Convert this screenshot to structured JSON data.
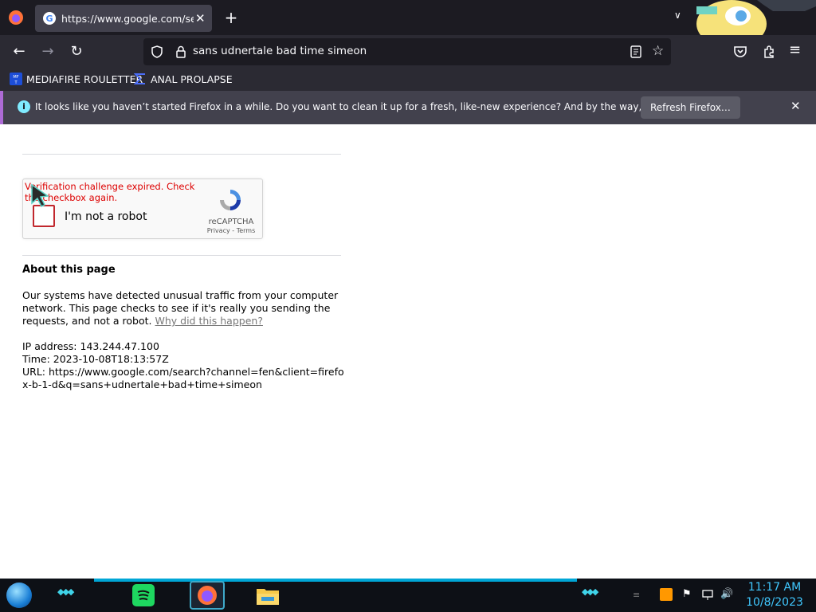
{
  "browser": {
    "tab": {
      "title": "https://www.google.com/search?channel=fen",
      "favicon": "google-favicon"
    },
    "url": "sans udnertale bad time simeon",
    "bookmarks": [
      {
        "label": "MEDIAFIRE ROULETTER",
        "icon": "mediafire-icon"
      },
      {
        "label": "ANAL PROLAPSE",
        "icon": "bookmark-sigma-icon"
      }
    ],
    "notification": {
      "text": "It looks like you haven’t started Firefox in a while. Do you want to clean it up for a fresh, like-new experience? And by the way, welcome back!",
      "button": "Refresh Firefox…"
    }
  },
  "page": {
    "captcha": {
      "error": "Verification challenge expired. Check the checkbox again.",
      "label": "I'm not a robot",
      "brand": "reCAPTCHA",
      "privacy": "Privacy",
      "sep": " - ",
      "terms": "Terms"
    },
    "about_title": "About this page",
    "about_text": "Our systems have detected unusual traffic from your computer network. This page checks to see if it's really you sending the requests, and not a robot.",
    "why_link": "Why did this happen?",
    "ip": "IP address: 143.244.47.100",
    "time": "Time: 2023-10-08T18:13:57Z",
    "url_line": "URL: https://www.google.com/search?channel=fen&client=firefox-b-1-d&q=sans+udnertale+bad+time+simeon"
  },
  "taskbar": {
    "apps": [
      "spotify-icon",
      "firefox-icon",
      "file-explorer-icon"
    ],
    "time": "11:17 AM",
    "date": "10/8/2023"
  },
  "colors": {
    "accent": "#40c8ff",
    "error": "#dd0000",
    "chrome": "#2b2a33"
  }
}
